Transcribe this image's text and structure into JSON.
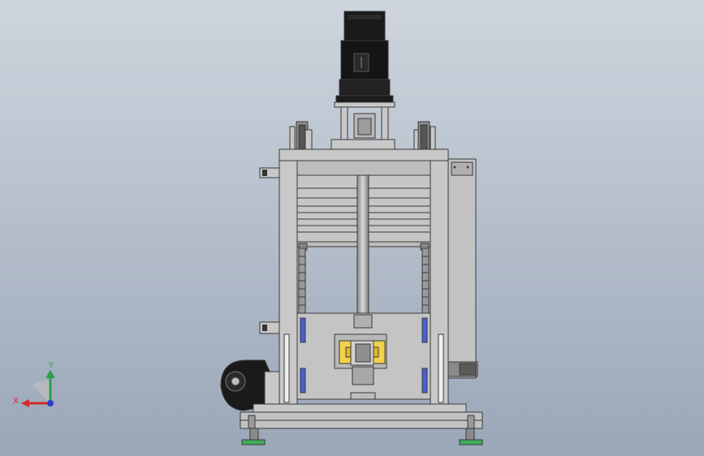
{
  "viewport": {
    "background_top": "#cfd5de",
    "background_bottom": "#9aa7b8"
  },
  "model": {
    "frame_color": "#c8c8c8",
    "edge_color": "#3a3a3a",
    "motor_color": "#1a1a1a",
    "clamp_color": "#f2d24a",
    "bearing_color": "#4a5fd6",
    "foot_color": "#3fae5a"
  },
  "triad": {
    "x_label": "X",
    "y_label": "Y",
    "x_color": "#d22a2a",
    "y_color": "#2aa04a",
    "z_color": "#2a3fd2"
  }
}
